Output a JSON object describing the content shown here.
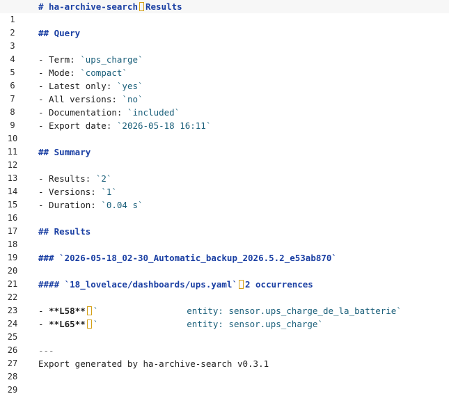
{
  "lines": [
    {
      "n": "1",
      "heading": "# ha-archive-search",
      "rest": "Results"
    },
    {
      "n": "2"
    },
    {
      "n": "3",
      "heading": "## Query"
    },
    {
      "n": "4"
    },
    {
      "n": "5",
      "prefix": "- Term: ",
      "code": "`ups_charge`"
    },
    {
      "n": "6",
      "prefix": "- Mode: ",
      "code": "`compact`"
    },
    {
      "n": "7",
      "prefix": "- Latest only: ",
      "code": "`yes`"
    },
    {
      "n": "8",
      "prefix": "- All versions: ",
      "code": "`no`"
    },
    {
      "n": "9",
      "prefix": "- Documentation: ",
      "code": "`included`"
    },
    {
      "n": "10",
      "prefix": "- Export date: ",
      "code": "`2026-05-18 16:11`"
    },
    {
      "n": "11"
    },
    {
      "n": "12",
      "heading": "## Summary"
    },
    {
      "n": "13"
    },
    {
      "n": "14",
      "prefix": "- Results: ",
      "code": "`2`"
    },
    {
      "n": "15",
      "prefix": "- Versions: ",
      "code": "`1`"
    },
    {
      "n": "16",
      "prefix": "- Duration: ",
      "code": "`0.04 s`"
    },
    {
      "n": "17"
    },
    {
      "n": "18",
      "heading": "## Results"
    },
    {
      "n": "19"
    },
    {
      "n": "20",
      "heading": "### `2026-05-18_02-30_Automatic_backup_2026.5.2_e53ab870`"
    },
    {
      "n": "21"
    },
    {
      "n": "22",
      "heading": "#### `18_lovelace/dashboards/ups.yaml`",
      "rest": "2 occurrences"
    },
    {
      "n": "23"
    },
    {
      "n": "24",
      "prefix": "- ",
      "bold": "**L58**",
      "tick": "`",
      "entity": "entity: sensor.ups_charge_de_la_batterie",
      "tail": "`"
    },
    {
      "n": "25",
      "prefix": "- ",
      "bold": "**L65**",
      "tick": "`",
      "entity": "entity: sensor.ups_charge",
      "tail": "`"
    },
    {
      "n": "26"
    },
    {
      "n": "27",
      "dim": "---"
    },
    {
      "n": "28",
      "text": "Export generated by ha-archive-search v0.3.1"
    },
    {
      "n": "29"
    }
  ]
}
